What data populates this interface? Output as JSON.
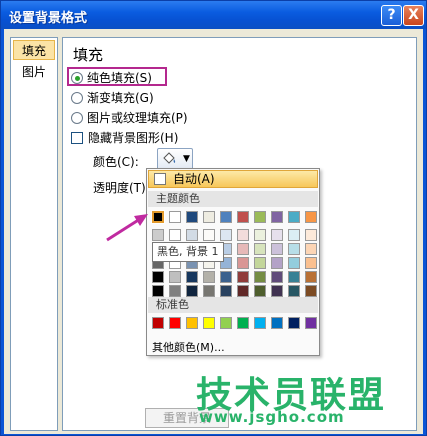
{
  "window": {
    "title": "设置背景格式",
    "help_label": "?",
    "close_label": "X"
  },
  "nav": {
    "items": [
      {
        "label": "填充"
      },
      {
        "label": "图片"
      }
    ]
  },
  "fill": {
    "section_title": "填充",
    "options": [
      {
        "label": "纯色填充(S)"
      },
      {
        "label": "渐变填充(G)"
      },
      {
        "label": "图片或纹理填充(P)"
      }
    ],
    "hide_bg_label": "隐藏背景图形(H)",
    "color_label": "颜色(C):",
    "transparency_label": "透明度(T):",
    "color_button_icon": "paint-bucket-icon",
    "reset_label": "重置背景"
  },
  "color_dropdown": {
    "auto_label": "自动(A)",
    "theme_header": "主题颜色",
    "standard_header": "标准色",
    "more_label": "其他颜色(M)...",
    "tooltip": "黑色, 背景 1",
    "theme_colors": [
      "#000000",
      "#ffffff",
      "#1f497d",
      "#eeece1",
      "#4f81bd",
      "#c0504d",
      "#9bbb59",
      "#8064a2",
      "#4bacc6",
      "#f79646"
    ],
    "standard_colors": [
      "#c00000",
      "#ff0000",
      "#ffc000",
      "#ffff00",
      "#92d050",
      "#00b050",
      "#00b0f0",
      "#0070c0",
      "#002060",
      "#7030a0"
    ]
  },
  "watermark": {
    "name": "技术员联盟",
    "url": "www.jsgho.com"
  }
}
